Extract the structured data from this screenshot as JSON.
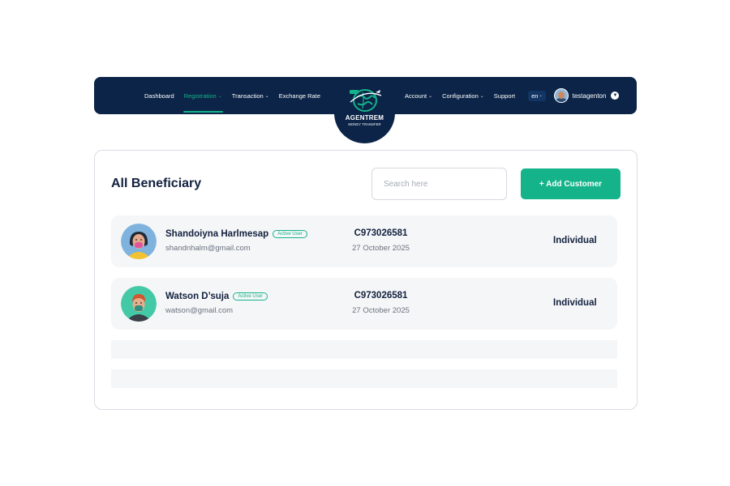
{
  "nav": {
    "left_items": [
      {
        "label": "Dashboard",
        "has_dropdown": false,
        "active": false
      },
      {
        "label": "Registration",
        "has_dropdown": true,
        "active": true
      },
      {
        "label": "Transaction",
        "has_dropdown": true,
        "active": false
      },
      {
        "label": "Exchange Rate",
        "has_dropdown": false,
        "active": false
      }
    ],
    "right_items": [
      {
        "label": "Account",
        "has_dropdown": true
      },
      {
        "label": "Configuration",
        "has_dropdown": true
      },
      {
        "label": "Support",
        "has_dropdown": false
      }
    ],
    "language": "en",
    "user": {
      "name": "testagenton",
      "avatar_icon": "user-avatar-icon"
    },
    "chevron": "⌄"
  },
  "logo": {
    "title": "AGENTREM",
    "subtitle": "MONEY TRANSFER",
    "icon": "globe-plane-icon"
  },
  "page": {
    "title": "All Beneficiary",
    "search_placeholder": "Search here",
    "add_button_label": "+ Add Customer"
  },
  "beneficiaries": [
    {
      "name": "Shandoiyna Harlmesap",
      "status": "Active User",
      "email": "shandnhalm@gmail.com",
      "account_id": "C973026581",
      "date": "27 October 2025",
      "type": "Individual",
      "avatar_icon": "female-avatar-icon"
    },
    {
      "name": "Watson D’suja",
      "status": "Active User",
      "email": "watson@gmail.com",
      "account_id": "C973026581",
      "date": "27 October 2025",
      "type": "Individual",
      "avatar_icon": "male-avatar-icon"
    }
  ],
  "colors": {
    "navy": "#0b2447",
    "accent": "#14b38a",
    "row_bg": "#f5f6f7",
    "text_muted": "#6a7180"
  }
}
